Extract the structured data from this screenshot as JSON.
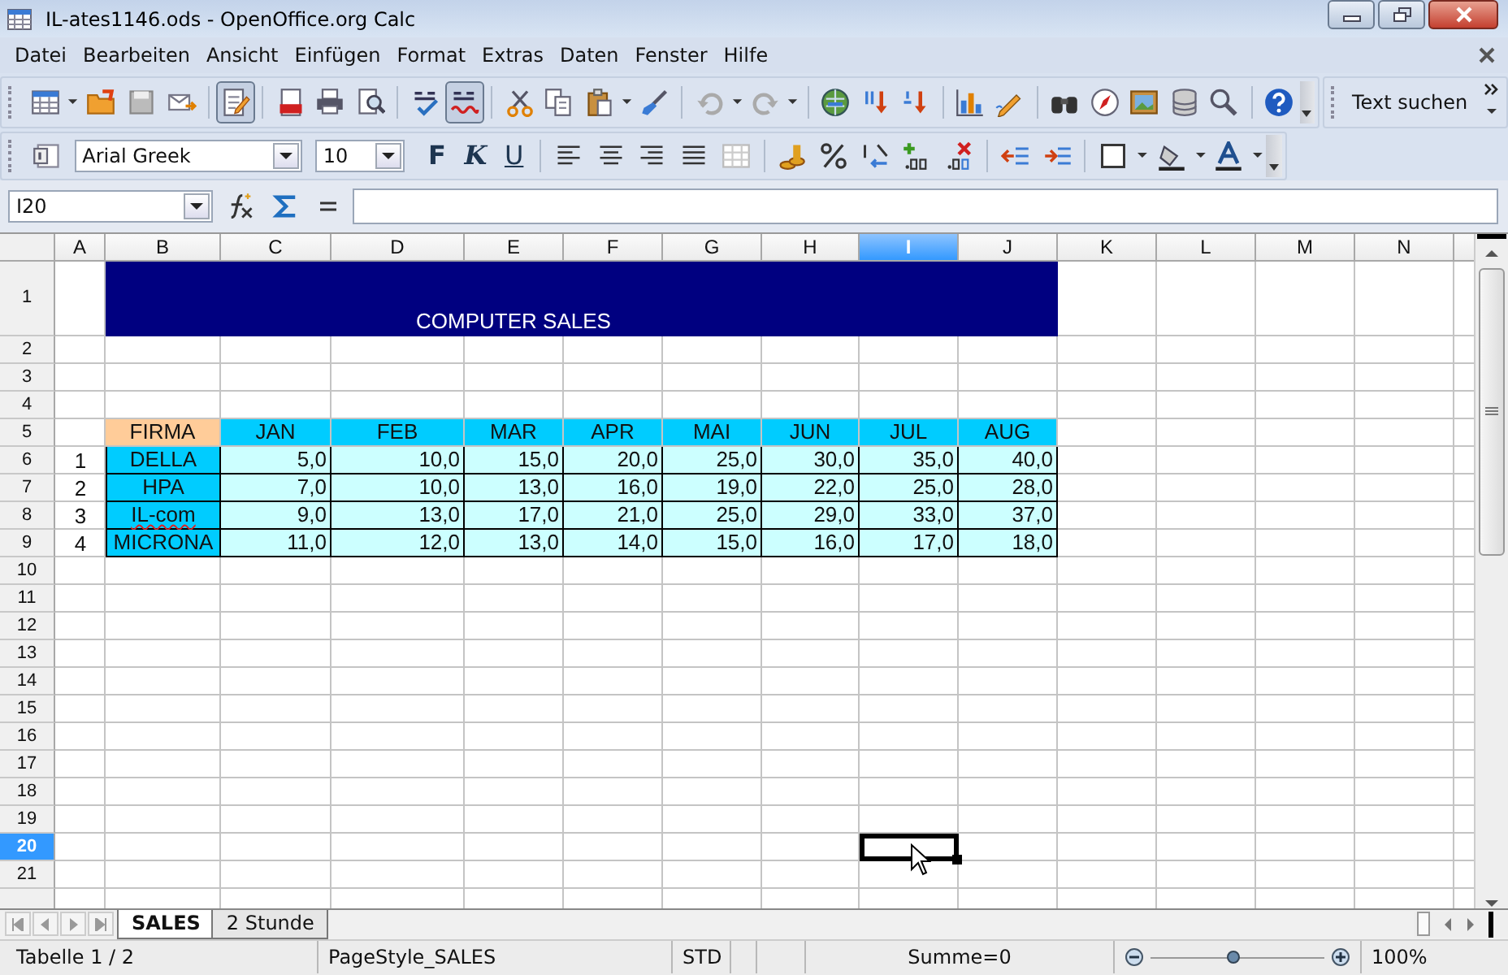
{
  "window": {
    "title": "IL-ates1146.ods - OpenOffice.org Calc"
  },
  "menu": [
    "Datei",
    "Bearbeiten",
    "Ansicht",
    "Einfügen",
    "Format",
    "Extras",
    "Daten",
    "Fenster",
    "Hilfe"
  ],
  "toolbar": {
    "edit_mode": true,
    "auto_spellcheck": true,
    "find_field": {
      "value": "Text suchen"
    }
  },
  "formatting": {
    "font_name": "Arial Greek",
    "font_size": "10",
    "style_buttons": [
      "F",
      "K",
      "U"
    ]
  },
  "formula_bar": {
    "name_box": "I20"
  },
  "sheet": {
    "columns": [
      {
        "label": "A",
        "selected": false
      },
      {
        "label": "B",
        "selected": false
      },
      {
        "label": "C",
        "selected": false
      },
      {
        "label": "D",
        "selected": false
      },
      {
        "label": "E",
        "selected": false
      },
      {
        "label": "F",
        "selected": false
      },
      {
        "label": "G",
        "selected": false
      },
      {
        "label": "H",
        "selected": false
      },
      {
        "label": "I",
        "selected": true
      },
      {
        "label": "J",
        "selected": false
      },
      {
        "label": "K",
        "selected": false
      },
      {
        "label": "L",
        "selected": false
      },
      {
        "label": "M",
        "selected": false
      },
      {
        "label": "N",
        "selected": false
      }
    ],
    "rows": [
      {
        "label": "1",
        "selected": false
      },
      {
        "label": "2",
        "selected": false
      },
      {
        "label": "3",
        "selected": false
      },
      {
        "label": "4",
        "selected": false
      },
      {
        "label": "5",
        "selected": false
      },
      {
        "label": "6",
        "selected": false
      },
      {
        "label": "7",
        "selected": false
      },
      {
        "label": "8",
        "selected": false
      },
      {
        "label": "9",
        "selected": false
      },
      {
        "label": "10",
        "selected": false
      },
      {
        "label": "11",
        "selected": false
      },
      {
        "label": "12",
        "selected": false
      },
      {
        "label": "13",
        "selected": false
      },
      {
        "label": "14",
        "selected": false
      },
      {
        "label": "15",
        "selected": false
      },
      {
        "label": "16",
        "selected": false
      },
      {
        "label": "17",
        "selected": false
      },
      {
        "label": "18",
        "selected": false
      },
      {
        "label": "19",
        "selected": false
      },
      {
        "label": "20",
        "selected": true
      },
      {
        "label": "21",
        "selected": false
      }
    ],
    "title": "COMPUTER SALES",
    "header": [
      "FIRMA",
      "JAN",
      "FEB",
      "MAR",
      "APR",
      "MAI",
      "JUN",
      "JUL",
      "AUG"
    ],
    "records": [
      {
        "number": "1",
        "company": "DELLA",
        "misspelled": false,
        "values": [
          "5,0",
          "10,0",
          "15,0",
          "20,0",
          "25,0",
          "30,0",
          "35,0",
          "40,0"
        ]
      },
      {
        "number": "2",
        "company": "HPA",
        "misspelled": false,
        "values": [
          "7,0",
          "10,0",
          "13,0",
          "16,0",
          "19,0",
          "22,0",
          "25,0",
          "28,0"
        ]
      },
      {
        "number": "3",
        "company": "IL-com",
        "misspelled": true,
        "values": [
          "9,0",
          "13,0",
          "17,0",
          "21,0",
          "25,0",
          "29,0",
          "33,0",
          "37,0"
        ]
      },
      {
        "number": "4",
        "company": "MICRONA",
        "misspelled": false,
        "values": [
          "11,0",
          "12,0",
          "13,0",
          "14,0",
          "15,0",
          "16,0",
          "17,0",
          "18,0"
        ]
      }
    ]
  },
  "sheet_tabs": [
    {
      "label": "SALES",
      "selected": true
    },
    {
      "label": "2 Stunde",
      "selected": false
    }
  ],
  "status_bar": {
    "sheet": "Tabelle 1 / 2",
    "page_style": "PageStyle_SALES",
    "mode": "STD",
    "sum": "Summe=0",
    "zoom_slider": {
      "level": 0.48
    },
    "zoom": "100%"
  }
}
